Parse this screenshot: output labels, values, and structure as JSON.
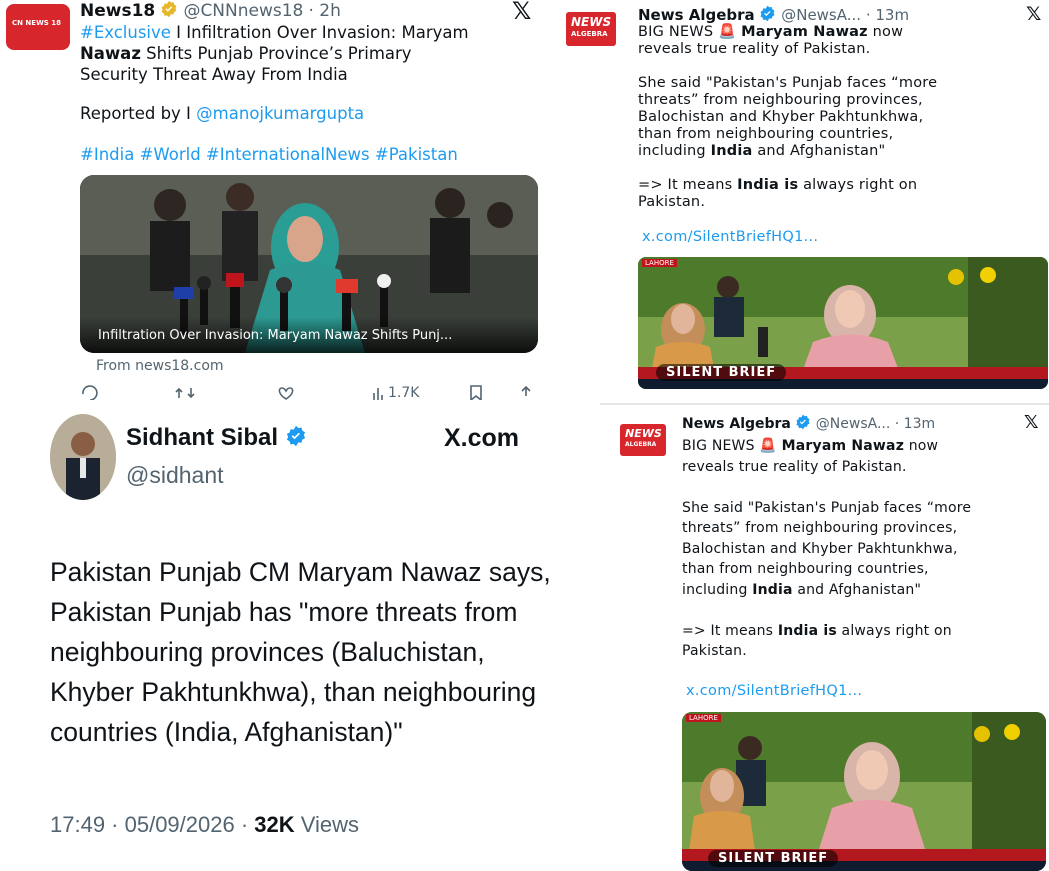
{
  "colors": {
    "accent": "#1d9bf0",
    "brand_red": "#d7262c",
    "text": "#0f1419",
    "muted": "#536471"
  },
  "tweet1": {
    "logo_text": "CN NEWS 18",
    "name": "News18",
    "handle": "@CNNnews18",
    "time": "· 2h",
    "hashtag_exclusive": "#Exclusive",
    "headline_rest": " I Infiltration Over Invasion: Maryam",
    "headline_bold": "Nawaz",
    "headline_line2": " Shifts Punjab Province’s Primary",
    "headline_line3": "Security Threat Away From India",
    "reported_by": "Reported by I ",
    "reporter": "@manojkumargupta",
    "hashtags": "#India #World #InternationalNews #Pakistan",
    "card_caption": "Infiltration Over Invasion: Maryam Nawaz Shifts Punj...",
    "card_source": "From news18.com",
    "count": "1.7K",
    "x_icon": "x-logo-icon"
  },
  "tweet2": {
    "logo_text_1": "NEWS",
    "logo_text_2": "ALGEBRA",
    "name": "News Algebra",
    "handle": "@NewsA...",
    "time": "· 13m",
    "line_big_news": "BIG NEWS",
    "siren": "🚨",
    "line_name": "Maryam Nawaz",
    "line_now": " now",
    "line2": "reveals true reality of Pakistan.",
    "para2_l1": "She said \"Pakistan's Punjab faces “more",
    "para2_l2": "threats” from neighbouring provinces,",
    "para2_l3": "Balochistan and Khyber Pakhtunkhwa,",
    "para2_l4": "than from neighbouring countries,",
    "para2_l5a": "including ",
    "para2_l5b": "India",
    "para2_l5c": " and Afghanistan\"",
    "para3_l1a": "=> It means ",
    "para3_l1b": "India is",
    "para3_l1c": " always right on",
    "para3_l2": "Pakistan.",
    "link": "x.com/SilentBriefHQ1...",
    "video_badge": "SILENT BRIEF",
    "lahore": "LAHORE"
  },
  "tweet3": {
    "name": "Sidhant Sibal",
    "handle": "@sidhant",
    "brand": "X.com",
    "body_l1": "Pakistan Punjab CM Maryam Nawaz says,",
    "body_l2": "Pakistan Punjab has \"more threats from",
    "body_l3": "neighbouring provinces (Baluchistan,",
    "body_l4": "Khyber Pakhtunkhwa), than neighbouring",
    "body_l5": "countries (India, Afghanistan)\"",
    "timestamp": "17:49 · 05/09/2026 · ",
    "views_count": "32K",
    "views_label": " Views"
  }
}
